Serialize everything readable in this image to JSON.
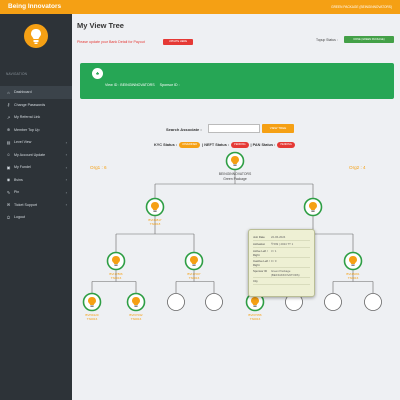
{
  "app": {
    "title": "Being Innovators",
    "top_status": "GREEN PACKAGE (BEINGINNOVATORS)"
  },
  "sidebar": {
    "section_title": "NAVIGATION",
    "items": [
      {
        "label": "Dashboard",
        "icon": "home-icon"
      },
      {
        "label": "Change Passwords",
        "icon": "key-icon"
      },
      {
        "label": "My Referral Link",
        "icon": "share-icon"
      },
      {
        "label": "Member Top Up",
        "icon": "topup-icon"
      },
      {
        "label": "Level View",
        "icon": "chart-icon",
        "expandable": true
      },
      {
        "label": "My Account Update",
        "icon": "user-icon",
        "expandable": true
      },
      {
        "label": "My Fundel",
        "icon": "wallet-icon",
        "expandable": true
      },
      {
        "label": "Bvins",
        "icon": "coin-icon",
        "expandable": true
      },
      {
        "label": "Pin",
        "icon": "pin-icon",
        "expandable": true
      },
      {
        "label": "Ticket Support",
        "icon": "ticket-icon",
        "expandable": true
      },
      {
        "label": "Logout",
        "icon": "logout-icon"
      }
    ]
  },
  "page": {
    "title": "My View Tree",
    "warning": "Please update your Bank Detail for Payout",
    "update_button": "UPDATE HERE",
    "topup_label": "Topup Status :",
    "topup_button": "DONE (GREEN PACKAGE)",
    "info_bar": {
      "view_id": "View ID : BEINGINNOVATORS",
      "sponsor_id": "Sponsor ID :"
    },
    "search": {
      "label": "Search Associate :",
      "value": "",
      "button": "VIEW TREE"
    },
    "status": {
      "kyc_label": "KYC Status :",
      "kyc_value": "UNVERIFIED",
      "neft_label": "| NEFT Status :",
      "neft_value": "PENDING",
      "pan_label": "| PAN Status :",
      "pan_value": "PENDING"
    },
    "org1": "Org1 : 6",
    "org2": "Org2 : 4"
  },
  "tree": {
    "root": {
      "id": "BEINGINNOVATORS",
      "package": "Green Package"
    },
    "level1": [
      {
        "label": "BVI49817\nTS0018"
      },
      {
        "label": ""
      }
    ],
    "level2": [
      {
        "label": "BVI17806\nTS0016"
      },
      {
        "label": "BVI17007\nTS0016"
      },
      {
        "label": ""
      },
      {
        "label": "BVI45061\nTS0016"
      }
    ],
    "level3": [
      {
        "label": "BVI59120\nTS0016"
      },
      {
        "label": "BVI67032\nTS0016"
      },
      {
        "label": ""
      },
      {
        "label": ""
      },
      {
        "label": "BVI67056\nTS0016"
      },
      {
        "label": ""
      },
      {
        "label": ""
      },
      {
        "label": ""
      }
    ]
  },
  "tooltip": {
    "rows": [
      {
        "k": "Join Date",
        "v": "22-06-2024"
      },
      {
        "k": "Activation",
        "v": "₹ 599 | 2024 TT 1"
      },
      {
        "k": "Active Left / Right",
        "v": "3 / 1"
      },
      {
        "k": "Inactive Left / Right",
        "v": "0 / 0"
      },
      {
        "k": "Sponsor ID",
        "v": "Green Package (BEINGINNOVATORS)"
      },
      {
        "k": "City",
        "v": ""
      }
    ]
  },
  "colors": {
    "accent": "#f5a014",
    "sidebar": "#2d3338",
    "green": "#26a655",
    "danger": "#e53935"
  }
}
